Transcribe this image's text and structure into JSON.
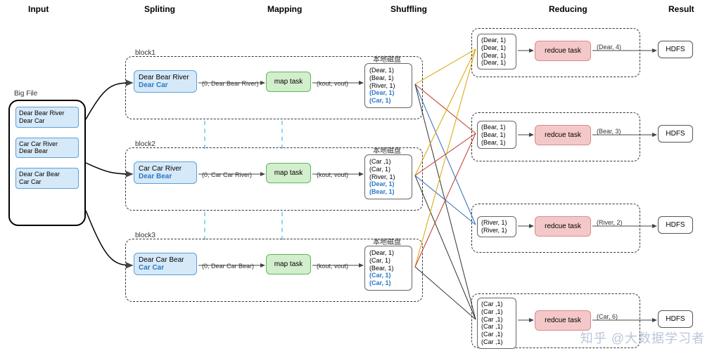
{
  "stages": {
    "input": "Input",
    "splitting": "Spliting",
    "mapping": "Mapping",
    "shuffling": "Shuffling",
    "reducing": "Reducing",
    "result": "Result"
  },
  "bigfile": {
    "title": "Big File",
    "lines": [
      "Dear Bear River\nDear Car",
      "Car Car River\nDear Bear",
      "Dear Car Bear\nCar Car"
    ]
  },
  "blocks": [
    {
      "name": "block1",
      "split_main": "Dear Bear River",
      "split_extra": "Dear Car",
      "map_in": "(0, Dear Bear River)",
      "map_task": "map task",
      "map_out": "(kout, vout)",
      "disk_title": "本地磁盘",
      "disk_lines": [
        "(Dear, 1)",
        "(Bear, 1)",
        "(River, 1)"
      ],
      "disk_extra": [
        "(Dear, 1)",
        "(Car, 1)"
      ]
    },
    {
      "name": "block2",
      "split_main": "Car Car River",
      "split_extra": "Dear Bear",
      "map_in": "(0, Car Car River)",
      "map_task": "map task",
      "map_out": "(kout, vout)",
      "disk_title": "本地磁盘",
      "disk_lines": [
        "(Car ,1)",
        "(Car, 1)",
        "(River, 1)"
      ],
      "disk_extra": [
        "(Dear, 1)",
        "(Bear, 1)"
      ]
    },
    {
      "name": "block3",
      "split_main": "Dear Car Bear",
      "split_extra": "Car Car",
      "map_in": "(0, Dear Car Bear)",
      "map_task": "map task",
      "map_out": "(kout, vout)",
      "disk_title": "本地磁盘",
      "disk_lines": [
        "(Dear, 1)",
        "(Car, 1)",
        "(Bear, 1)"
      ],
      "disk_extra": [
        "(Car, 1)",
        "(Car, 1)"
      ]
    }
  ],
  "reducers": [
    {
      "inputs": [
        "(Dear, 1)",
        "(Dear, 1)",
        "(Dear, 1)",
        "(Dear, 1)"
      ],
      "task": "redcue task",
      "output": "(Dear, 4)",
      "hdfs": "HDFS"
    },
    {
      "inputs": [
        "(Bear, 1)",
        "(Bear, 1)",
        "(Bear, 1)"
      ],
      "task": "redcue task",
      "output": "(Bear, 3)",
      "hdfs": "HDFS"
    },
    {
      "inputs": [
        "(River, 1)",
        "(River, 1)"
      ],
      "task": "redcue task",
      "output": "(River, 2)",
      "hdfs": "HDFS"
    },
    {
      "inputs": [
        "(Car ,1)",
        "(Car ,1)",
        "(Car ,1)",
        "(Car ,1)",
        "(Car ,1)",
        "(Car ,1)"
      ],
      "task": "redcue task",
      "output": "(Car, 6)",
      "hdfs": "HDFS"
    }
  ],
  "watermark": "知乎 @大数据学习者"
}
